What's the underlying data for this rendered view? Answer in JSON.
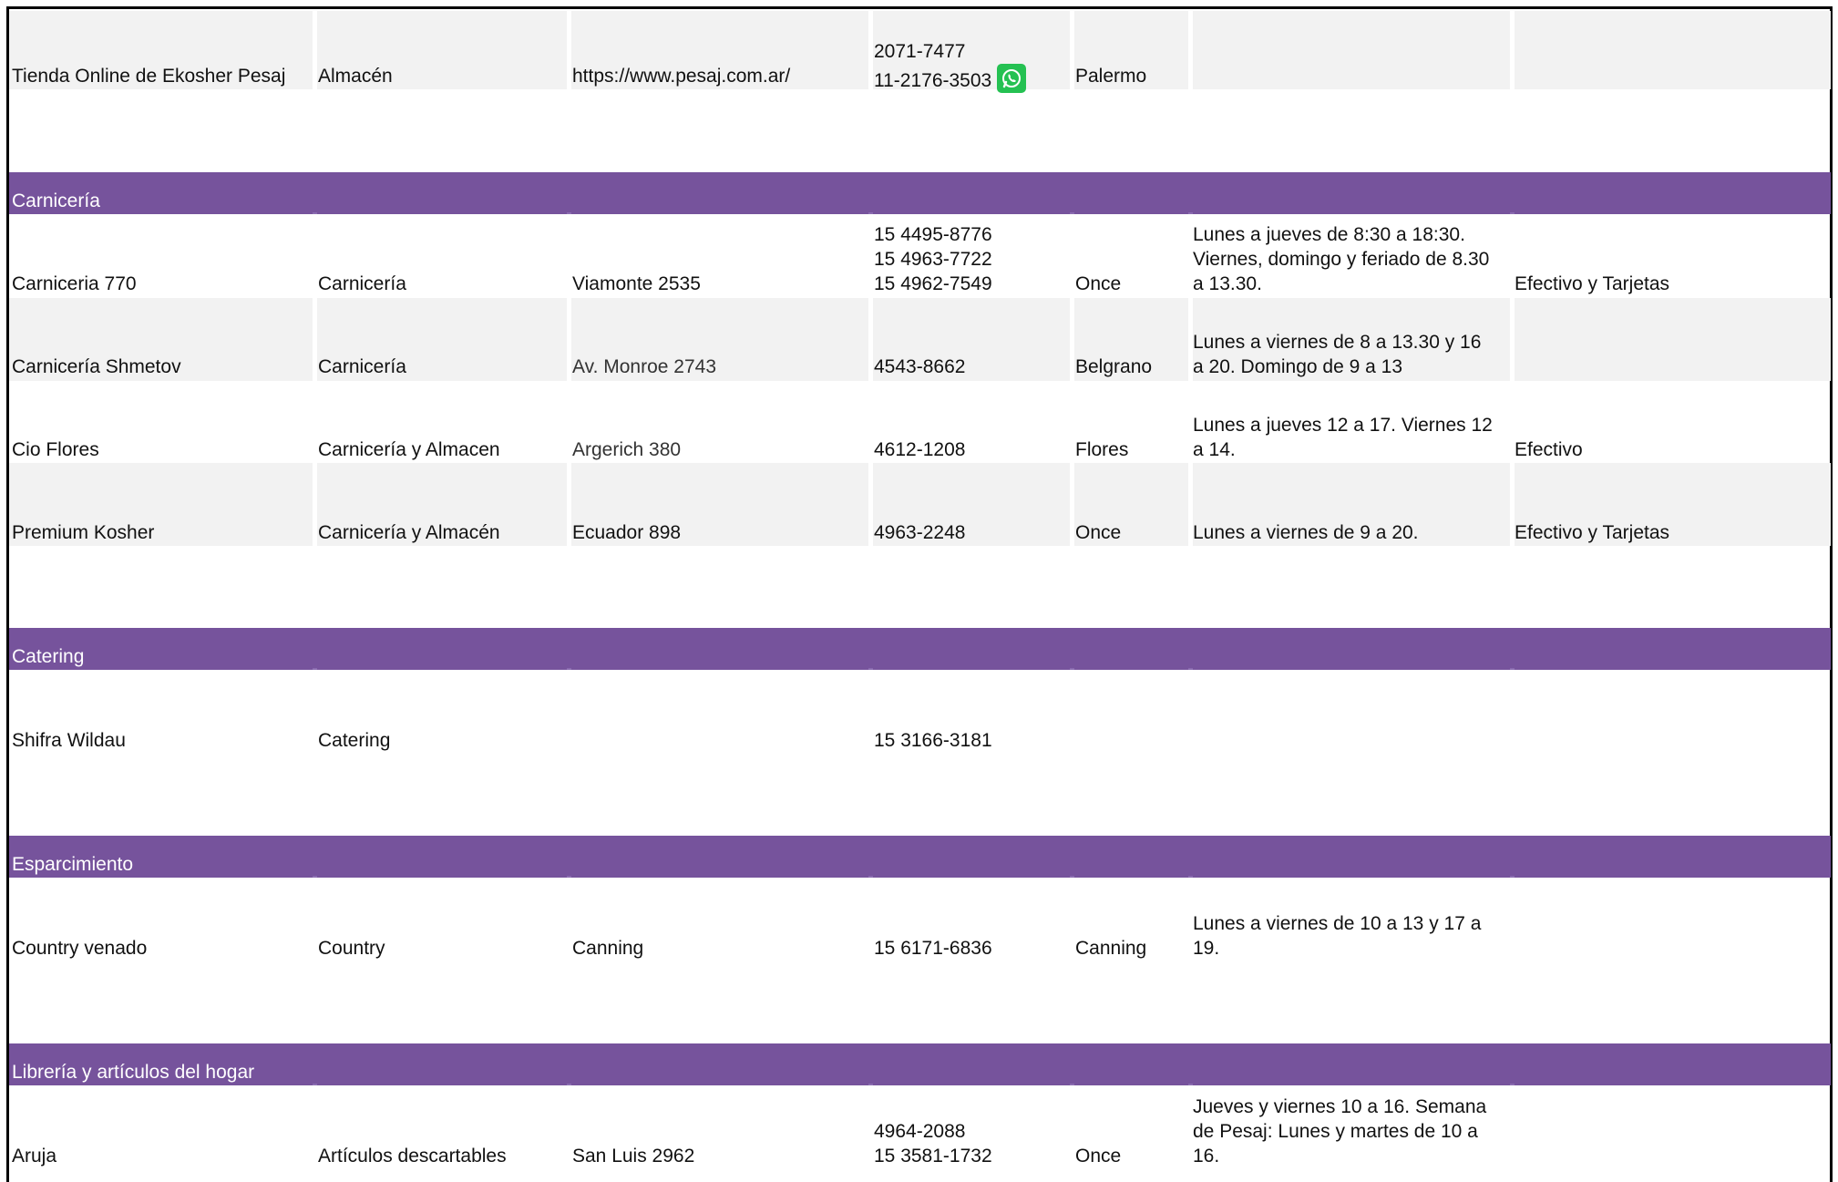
{
  "colors": {
    "category_header": "#76539c",
    "band": "#f2f2f2",
    "whatsapp": "#25c152"
  },
  "top_row": {
    "name": "Tienda Online de Ekosher Pesaj",
    "type": "Almacén",
    "address": "https://www.pesaj.com.ar/",
    "phone_1": "2071-7477",
    "phone_2": "11-2176-3503",
    "phone_icon": "whatsapp-icon",
    "area": "Palermo"
  },
  "sections": {
    "carniceria": {
      "title": "Carnicería",
      "rows": [
        {
          "name": "Carniceria 770",
          "type": "Carnicería",
          "address": "Viamonte 2535",
          "phones": [
            "15 4495-8776",
            "15 4963-7722",
            "15 4962-7549"
          ],
          "area": "Once",
          "hours": [
            "Lunes a jueves de 8:30 a 18:30.",
            "Viernes, domingo y feriado de 8.30",
            "a 13.30."
          ],
          "payment": "Efectivo y Tarjetas"
        },
        {
          "name": "Carnicería Shmetov",
          "type": "Carnicería",
          "address": "Av. Monroe 2743",
          "phones": [
            "4543-8662"
          ],
          "area": "Belgrano",
          "hours": [
            "Lunes a viernes de 8 a 13.30 y 16",
            "a 20. Domingo de 9 a 13"
          ],
          "payment": ""
        },
        {
          "name": "Cio Flores",
          "type": "Carnicería y Almacen",
          "address": "Argerich 380",
          "phones": [
            "4612-1208"
          ],
          "area": "Flores",
          "hours": [
            "Lunes a jueves 12 a 17. Viernes 12",
            "a 14."
          ],
          "payment": "Efectivo"
        },
        {
          "name": "Premium Kosher",
          "type": "Carnicería y Almacén",
          "address": "Ecuador 898",
          "phones": [
            "4963-2248"
          ],
          "area": "Once",
          "hours": [
            "Lunes a viernes de 9 a 20."
          ],
          "payment": "Efectivo y Tarjetas"
        }
      ]
    },
    "catering": {
      "title": "Catering",
      "rows": [
        {
          "name": "Shifra Wildau",
          "type": "Catering",
          "address": "",
          "phones": [
            "15 3166-3181"
          ],
          "area": "",
          "hours": [],
          "payment": ""
        }
      ]
    },
    "esparcimiento": {
      "title": "Esparcimiento",
      "rows": [
        {
          "name": "Country venado",
          "type": "Country",
          "address": "Canning",
          "phones": [
            "15 6171-6836"
          ],
          "area": "Canning",
          "hours": [
            "Lunes a viernes de 10 a 13 y 17 a",
            "19."
          ],
          "payment": ""
        }
      ]
    },
    "libreria": {
      "title": "Librería y artículos del hogar",
      "rows": [
        {
          "name": "Aruja",
          "type": "Artículos descartables",
          "address": "San Luis 2962",
          "phones": [
            "4964-2088",
            "15 3581-1732"
          ],
          "area": "Once",
          "hours": [
            "Jueves y viernes 10 a 16. Semana",
            "de Pesaj: Lunes y martes de 10 a",
            "16."
          ],
          "payment": ""
        }
      ]
    }
  }
}
